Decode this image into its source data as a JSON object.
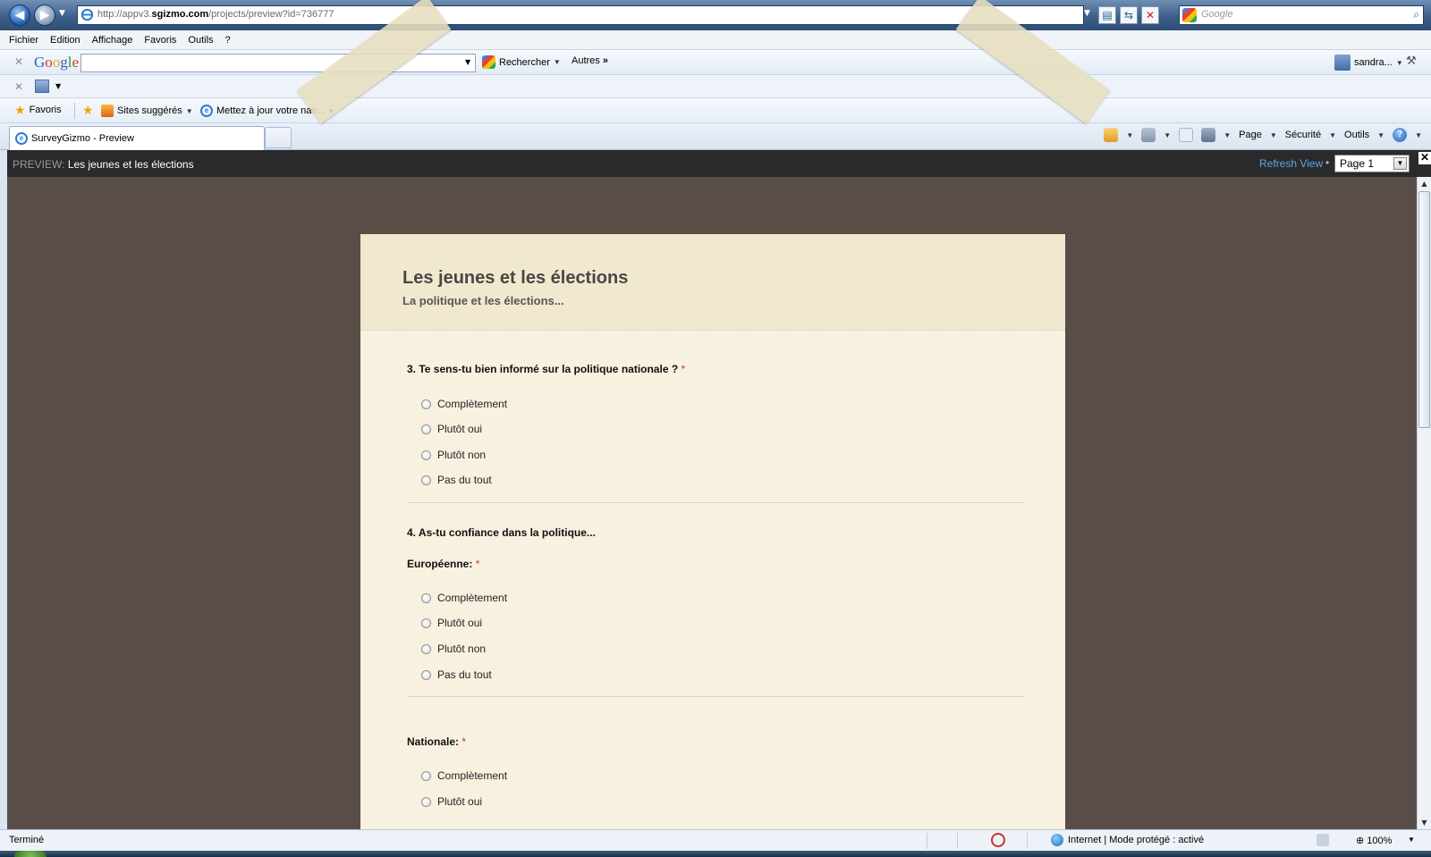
{
  "browser": {
    "url_prefix": "http://appv3.",
    "url_domain": "sgizmo.com",
    "url_path": "/projects/preview?id=736777",
    "search_placeholder": "Google",
    "menu": [
      "Fichier",
      "Edition",
      "Affichage",
      "Favoris",
      "Outils",
      "?"
    ],
    "google_toolbar": {
      "logo_letters": [
        "G",
        "o",
        "o",
        "g",
        "l",
        "e"
      ],
      "search_label": "Rechercher",
      "more_label": "Autres",
      "user_label": "sandra..."
    },
    "favorites": {
      "favorites_label": "Favoris",
      "suggested_sites": "Sites suggérés",
      "update_browser": "Mettez à jour votre nav..."
    },
    "tab": {
      "title": "SurveyGizmo - Preview"
    },
    "command_bar": {
      "page_label": "Page",
      "security_label": "Sécurité",
      "tools_label": "Outils"
    },
    "status": {
      "text": "Terminé",
      "zone": "Internet | Mode protégé : activé",
      "zoom": "100%"
    }
  },
  "preview": {
    "prefix": "PREVIEW:",
    "title": "Les jeunes et les élections",
    "refresh_label": "Refresh View",
    "separator": "•",
    "page_select": "Page 1"
  },
  "survey": {
    "title": "Les jeunes et les élections",
    "subtitle": "La politique et les élections...",
    "required_mark": "*",
    "q3": {
      "label": "3. Te sens-tu bien informé sur la politique nationale ?",
      "options": [
        "Complètement",
        "Plutôt oui",
        "Plutôt non",
        "Pas du tout"
      ]
    },
    "q4": {
      "label": "4. As-tu confiance dans la politique...",
      "europe": {
        "label": "Européenne:",
        "options": [
          "Complètement",
          "Plutôt oui",
          "Plutôt non",
          "Pas du tout"
        ]
      },
      "nationale": {
        "label": "Nationale:",
        "options": [
          "Complètement",
          "Plutôt oui"
        ]
      }
    }
  },
  "colors": {
    "page_background": "#594e47",
    "paper": "#f8f1e0",
    "preview_bar": "#2a2a2a",
    "refresh_link": "#5fa8e6",
    "required": "#c0392b"
  }
}
